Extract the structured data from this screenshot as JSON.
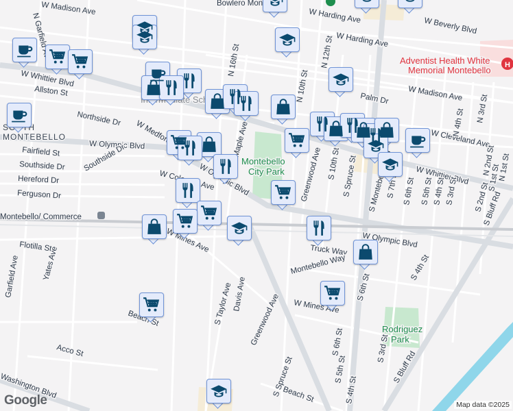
{
  "map": {
    "logo": "Google",
    "attribution": "Map data ©2025",
    "places": {
      "park1": "Montebello",
      "park1b": "City Park",
      "park2": "Rodriguez",
      "park2b": "Park",
      "hospital1": "Adventist Health White",
      "hospital2": "Memorial Montebello",
      "bowling": "Bowlero Montebello",
      "area1": "SOUTH",
      "area2": "MONTEBELLO",
      "station": "Montebello/ Commerce",
      "school_lbl": "Intermediate School"
    },
    "streets": [
      "W Madison Ave",
      "N Garfield Ave",
      "W Whittier Blvd",
      "Allston St",
      "Northside Dr",
      "W Olympic Blvd",
      "Fairfield St",
      "Southside Dr",
      "Southside Dr",
      "Hereford Dr",
      "Ferguson Dr",
      "W Medford Ave",
      "W Coleman Ave",
      "W Olympic Blvd",
      "Maple Ave",
      "N 16th St",
      "W Harding Ave",
      "W Beverly Blvd",
      "W Harding Ave",
      "N 12th St",
      "Palm Dr",
      "W Madison Ave",
      "W Cleveland Ave",
      "W Whittier Blvd",
      "Greenwood Ave",
      "S 10th St",
      "S Spruce St",
      "S Montebello Blvd",
      "S 7th St",
      "S 6th St",
      "S 5th St",
      "S 4th St",
      "S 3rd St",
      "S 2nd St",
      "S 1st St",
      "N 4th St",
      "N 3rd St",
      "N 2nd St",
      "N 1st St",
      "S Bluff Rd",
      "W Olympic Blvd",
      "Truck Way",
      "Montebello Way",
      "W Mines Ave",
      "S 4th St",
      "Flotilla St",
      "Garfield Ave",
      "Yates Ave",
      "W Mines Ave",
      "S Taylor Ave",
      "Davis Ave",
      "Greenwood Ave",
      "Beach St",
      "Acco St",
      "Washington Blvd",
      "S Spruce St",
      "Beach St",
      "S 6th St",
      "S 5th St",
      "S 4th St",
      "S 3rd St",
      "S Bluff Rd",
      "S 6th St",
      "N 10th St"
    ],
    "marker_types": [
      "school-icon",
      "cart-icon",
      "cup-icon",
      "food-icon",
      "shop-icon"
    ],
    "colors": {
      "marker_fill": "#e4ebfb",
      "marker_border": "#6f93d6",
      "icon": "#0b4a6e",
      "park": "#c8e8cf",
      "water": "#8fd6ea",
      "hospital": "#f9dede"
    }
  }
}
